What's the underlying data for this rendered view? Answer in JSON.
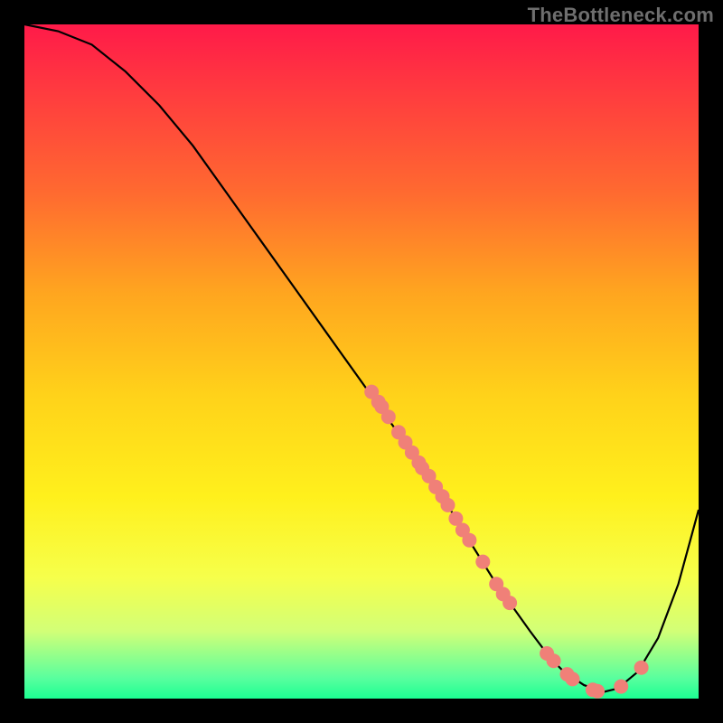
{
  "watermark": "TheBottleneck.com",
  "colors": {
    "background": "#000000",
    "curve": "#000000",
    "dot": "#f08078",
    "gradient_top": "#ff1a49",
    "gradient_bottom": "#1cff92"
  },
  "chart_data": {
    "type": "line",
    "title": "",
    "xlabel": "",
    "ylabel": "",
    "xlim": [
      0,
      100
    ],
    "ylim": [
      0,
      100
    ],
    "series": [
      {
        "name": "curve",
        "x": [
          0,
          5,
          10,
          15,
          20,
          25,
          30,
          35,
          40,
          45,
          50,
          55,
          60,
          62,
          65,
          70,
          75,
          78,
          80,
          83,
          86,
          88,
          91,
          94,
          97,
          100
        ],
        "values": [
          100,
          99,
          97,
          93,
          88,
          82,
          75,
          68,
          61,
          54,
          47,
          40,
          33,
          30,
          25,
          17,
          10,
          6,
          4,
          2,
          1,
          1.5,
          4,
          9,
          17,
          28
        ]
      }
    ],
    "scatter": [
      {
        "x": 51.5,
        "y": 45.5
      },
      {
        "x": 52.5,
        "y": 44.0
      },
      {
        "x": 53.0,
        "y": 43.3
      },
      {
        "x": 54.0,
        "y": 41.8
      },
      {
        "x": 55.5,
        "y": 39.5
      },
      {
        "x": 56.5,
        "y": 38.0
      },
      {
        "x": 57.5,
        "y": 36.5
      },
      {
        "x": 58.5,
        "y": 35.0
      },
      {
        "x": 59.0,
        "y": 34.2
      },
      {
        "x": 60.0,
        "y": 33.0
      },
      {
        "x": 61.0,
        "y": 31.4
      },
      {
        "x": 62.0,
        "y": 30.0
      },
      {
        "x": 62.8,
        "y": 28.7
      },
      {
        "x": 64.0,
        "y": 26.7
      },
      {
        "x": 65.0,
        "y": 25.0
      },
      {
        "x": 66.0,
        "y": 23.5
      },
      {
        "x": 68.0,
        "y": 20.3
      },
      {
        "x": 70.0,
        "y": 17.0
      },
      {
        "x": 71.0,
        "y": 15.5
      },
      {
        "x": 72.0,
        "y": 14.2
      },
      {
        "x": 77.5,
        "y": 6.7
      },
      {
        "x": 78.5,
        "y": 5.6
      },
      {
        "x": 80.5,
        "y": 3.6
      },
      {
        "x": 81.3,
        "y": 2.9
      },
      {
        "x": 84.3,
        "y": 1.3
      },
      {
        "x": 85.0,
        "y": 1.1
      },
      {
        "x": 88.5,
        "y": 1.8
      },
      {
        "x": 91.5,
        "y": 4.6
      }
    ]
  }
}
